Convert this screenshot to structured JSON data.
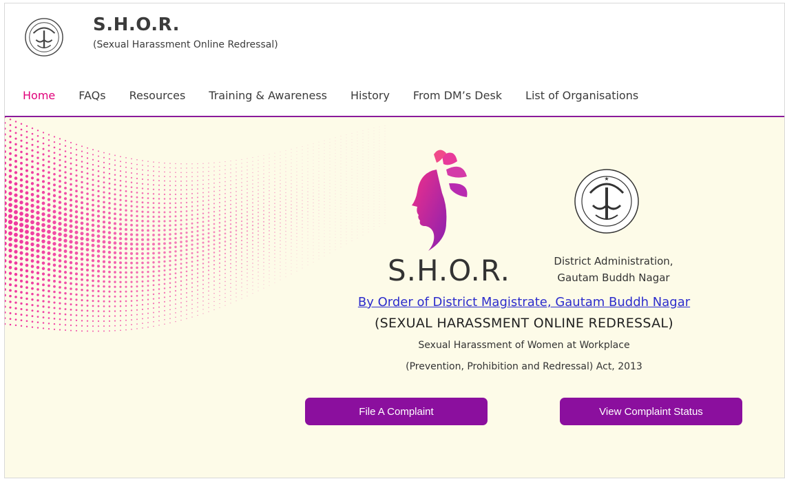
{
  "header": {
    "title": "S.H.O.R.",
    "subtitle": "(Sexual Harassment Online Redressal)",
    "emblem_icon": "up-govt-emblem-icon"
  },
  "nav": {
    "items": [
      {
        "label": "Home",
        "active": true
      },
      {
        "label": "FAQs",
        "active": false
      },
      {
        "label": "Resources",
        "active": false
      },
      {
        "label": "Training & Awareness",
        "active": false
      },
      {
        "label": "History",
        "active": false
      },
      {
        "label": "From DM’s Desk",
        "active": false
      },
      {
        "label": "List of Organisations",
        "active": false
      }
    ]
  },
  "hero": {
    "logo_icon": "woman-profile-logo-icon",
    "logo_text": "S.H.O.R.",
    "dm_emblem_icon": "up-govt-emblem-icon",
    "dm_line1": "District Administration,",
    "dm_line2": "Gautam Buddh Nagar",
    "order_link": "By Order of District Magistrate, Gautam Buddh Nagar",
    "redressal_title": "(SEXUAL HARASSMENT ONLINE REDRESSAL)",
    "act_line1": "Sexual Harassment of Women at Workplace",
    "act_line2": "(Prevention, Prohibition and Redressal) Act, 2013",
    "file_button": "File A Complaint",
    "view_button": "View Complaint Status"
  },
  "colors": {
    "accent_pink": "#e0007a",
    "button_purple": "#8b0f9e",
    "hero_bg": "#fdfbe8",
    "link_blue": "#2c2ccc"
  }
}
